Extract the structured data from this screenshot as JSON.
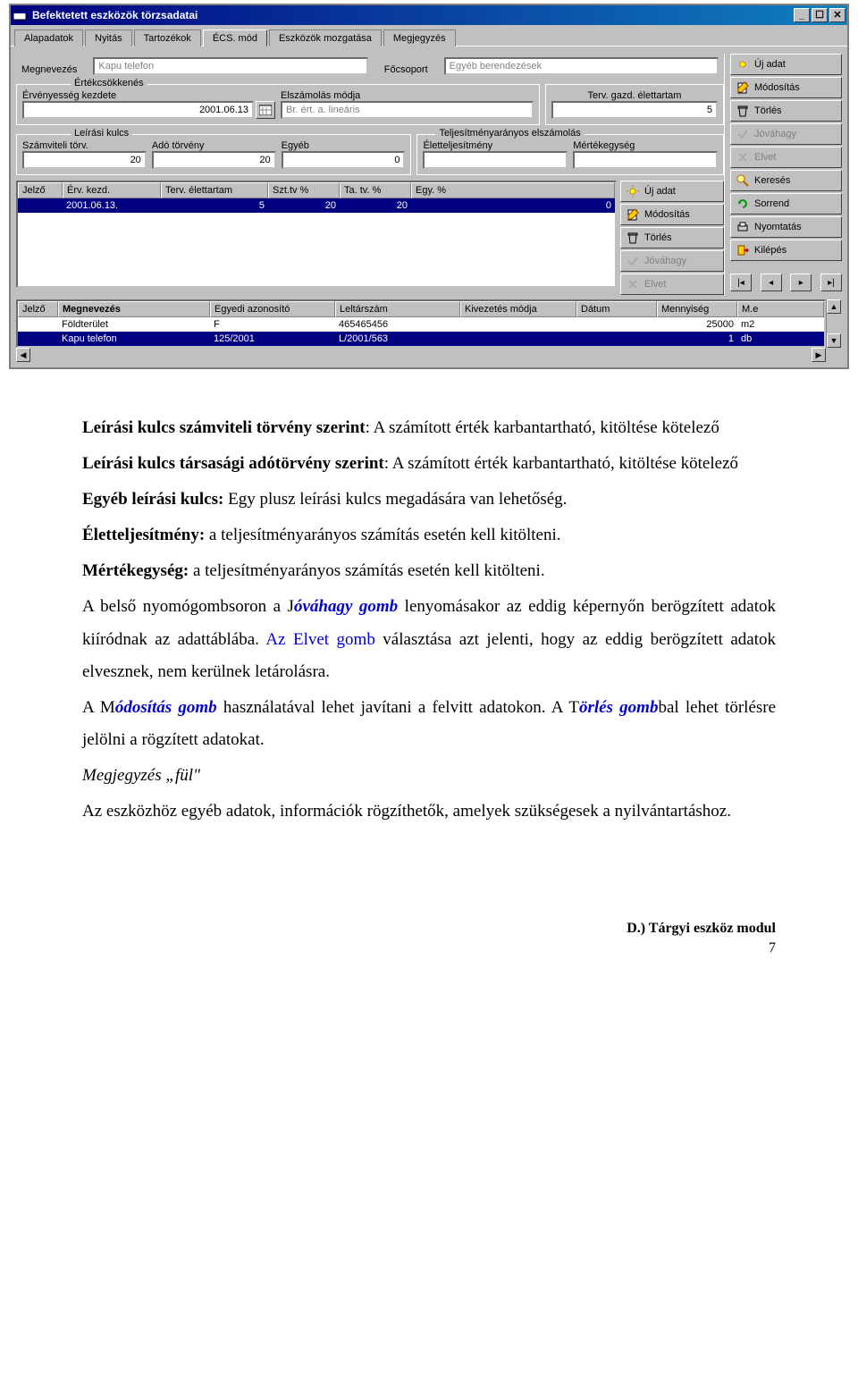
{
  "window": {
    "title": "Befektetett eszközök törzsadatai",
    "tabs": [
      "Alapadatok",
      "Nyitás",
      "Tartozékok",
      "ÉCS. mód",
      "Eszközök mozgatása",
      "Megjegyzés"
    ],
    "active_tab": 3
  },
  "form": {
    "megnevezes_label": "Megnevezés",
    "megnevezes_value": "Kapu telefon",
    "focsoport_label": "Főcsoport",
    "focsoport_value": "Egyéb berendezések",
    "ertekcsokkenes_title": "Értékcsökkenés",
    "ervenyesseg_label": "Érvényesség kezdete",
    "ervenyesseg_value": "2001.06.13",
    "elszamolas_label": "Elszámolás módja",
    "elszamolas_value": "Br. ért. a. lineáris",
    "terv_label": "Terv. gazd. élettartam",
    "terv_value": "5",
    "leirasi_title": "Leírási kulcs",
    "szamv_label": "Számviteli törv.",
    "szamv_value": "20",
    "ado_label": "Adó törvény",
    "ado_value": "20",
    "egyeb_label": "Egyéb",
    "egyeb_value": "0",
    "telj_title": "Teljesítményarányos elszámolás",
    "elettelj_label": "Életteljesítmény",
    "elettelj_value": "",
    "mertek_label": "Mértékegység",
    "mertek_value": ""
  },
  "inner_grid": {
    "cols": [
      "Jelző",
      "Érv. kezd.",
      "Terv. élettartam",
      "Szt.tv %",
      "Ta. tv. %",
      "Egy. %"
    ],
    "row": [
      "",
      "2001.06.13.",
      "5",
      "20",
      "20",
      "0"
    ]
  },
  "inner_btns": {
    "uj": "Új adat",
    "mod": "Módosítás",
    "tor": "Törlés",
    "jov": "Jóváhagy",
    "elv": "Elvet"
  },
  "side_btns": {
    "uj": "Új adat",
    "mod": "Módosítás",
    "tor": "Törlés",
    "jov": "Jóváhagy",
    "elv": "Elvet",
    "ker": "Keresés",
    "sor": "Sorrend",
    "nyo": "Nyomtatás",
    "kil": "Kilépés"
  },
  "grid2": {
    "cols": [
      "Jelző",
      "Megnevezés",
      "Egyedi azonosító",
      "Leltárszám",
      "Kivezetés módja",
      "Dátum",
      "Mennyiség",
      "M.e"
    ],
    "rows": [
      [
        "",
        "Földterület",
        "F",
        "465465456",
        "",
        "",
        "25000",
        "m2"
      ],
      [
        "",
        "Kapu telefon",
        "125/2001",
        "L/2001/563",
        "",
        "",
        "1",
        "db"
      ]
    ],
    "selected": 1
  },
  "text": {
    "p1a": "Leírási kulcs számviteli törvény szerint",
    "p1b": ": A számított érték karbantartható, kitöltése kötelező",
    "p2a": "Leírási kulcs társasági adótörvény szerint",
    "p2b": ": A számított érték karbantartható, kitöltése kötelező",
    "p3a": "Egyéb leírási kulcs:",
    "p3b": " Egy plusz leírási kulcs megadására van lehetőség.",
    "p4a": "Életteljesítmény:",
    "p4b": " a teljesítményarányos számítás esetén kell kitölteni.",
    "p5a": "Mértékegység:",
    "p5b": " a teljesítményarányos számítás esetén kell kitölteni.",
    "p6a": "A belső nyomógombsoron a J",
    "p6b": "óváhagy gomb",
    "p6c": " lenyomásakor az eddig képernyőn berögzített adatok kiíródnak az adattáblába. ",
    "p6d": "Az Elvet gomb",
    "p6e": " választása azt jelenti, hogy az eddig berögzített adatok elvesznek, nem kerülnek letárolásra.",
    "p7a": "A M",
    "p7b": "ódosítás gomb",
    "p7c": " használatával lehet javítani a felvitt adatokon. ",
    "p7d": " A T",
    "p7e": "örlés gomb",
    "p7f": "bal lehet törlésre jelölni a rögzített adatokat.",
    "p8": "Megjegyzés „fül\"",
    "p9": "Az eszközhöz egyéb adatok, információk rögzíthetők, amelyek szükségesek a nyilvántartáshoz.",
    "footer": "D.) Tárgyi eszköz modul",
    "pnum": "7"
  }
}
